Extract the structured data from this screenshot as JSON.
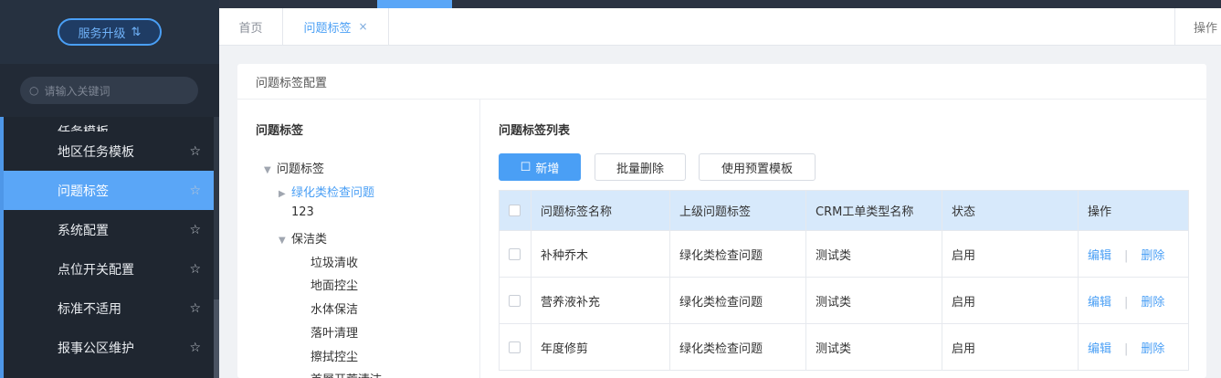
{
  "sidebar": {
    "upgrade_label": "服务升级",
    "upgrade_icon": "swap-arrows-icon",
    "search_placeholder": "请输入关键词",
    "items": [
      {
        "label": "任务模板",
        "partial": true
      },
      {
        "label": "地区任务模板"
      },
      {
        "label": "问题标签",
        "active": true
      },
      {
        "label": "系统配置"
      },
      {
        "label": "点位开关配置"
      },
      {
        "label": "标准不适用"
      },
      {
        "label": "报事公区维护"
      }
    ]
  },
  "tabs": {
    "home": "首页",
    "active": "问题标签",
    "close": "×",
    "ops": "操作"
  },
  "panel": {
    "title": "问题标签配置",
    "tree": {
      "title": "问题标签",
      "nodes": [
        {
          "label": "问题标签",
          "level": 0,
          "arrow": "▼"
        },
        {
          "label": "绿化类检查问题",
          "level": 1,
          "arrow": "▶",
          "selected": true
        },
        {
          "label": "123",
          "level": 1,
          "arrow": ""
        },
        {
          "label": "保洁类",
          "level": 1,
          "arrow": "▼"
        },
        {
          "label": "垃圾清收",
          "level": 2,
          "arrow": ""
        },
        {
          "label": "地面控尘",
          "level": 2,
          "arrow": ""
        },
        {
          "label": "水体保洁",
          "level": 2,
          "arrow": ""
        },
        {
          "label": "落叶清理",
          "level": 2,
          "arrow": ""
        },
        {
          "label": "擦拭控尘",
          "level": 2,
          "arrow": ""
        },
        {
          "label": "首層开荒清洁",
          "level": 2,
          "arrow": ""
        }
      ]
    },
    "list": {
      "title": "问题标签列表",
      "add_label": "新增",
      "batch_delete_label": "批量删除",
      "template_label": "使用预置模板",
      "columns": [
        "问题标签名称",
        "上级问题标签",
        "CRM工单类型名称",
        "状态",
        "操作"
      ],
      "rows": [
        [
          "补种乔木",
          "绿化类检查问题",
          "测试类",
          "启用"
        ],
        [
          "营养液补充",
          "绿化类检查问题",
          "测试类",
          "启用"
        ],
        [
          "年度修剪",
          "绿化类检查问题",
          "测试类",
          "启用"
        ]
      ],
      "edit_label": "编辑",
      "sep": "|",
      "delete_label": "删除"
    }
  },
  "colors": {
    "accent": "#4a9ff5",
    "sidebar_bg": "#1f2630",
    "active_item": "#5aa6f7",
    "header_row": "#d7e9fb"
  }
}
